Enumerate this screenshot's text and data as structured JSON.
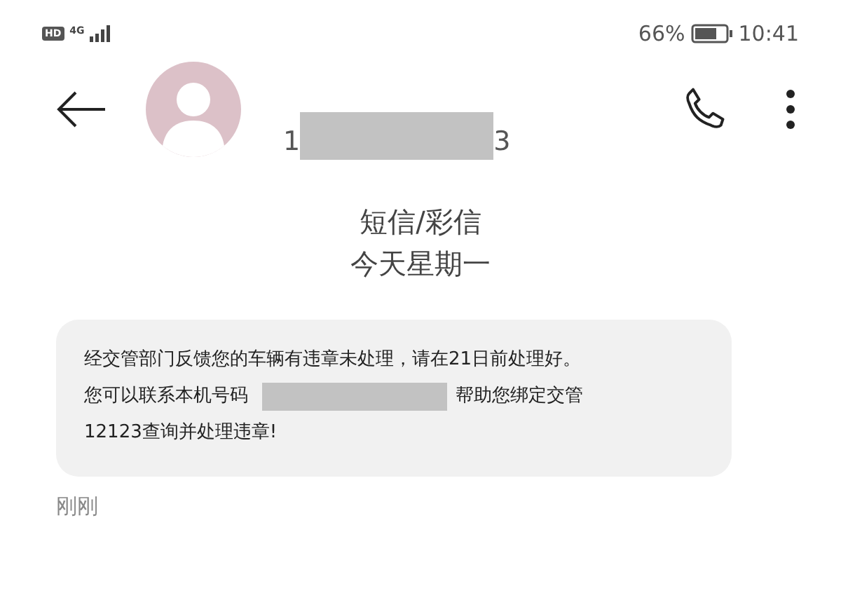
{
  "status_bar": {
    "hd": "HD",
    "network": "4G",
    "battery": "66%",
    "time": "10:41"
  },
  "header": {
    "number_start": "1",
    "number_end": "3"
  },
  "thread": {
    "channel": "短信/彩信",
    "date": "今天星期一"
  },
  "message": {
    "line_1": "经交管部门反馈您的车辆有违章未处理，请在21日前处理好。",
    "line_2": [
      "您可以联系本机号码",
      "帮助您绑定交管"
    ],
    "line_3": "12123查询并处理违章!",
    "time": "刚刚"
  }
}
